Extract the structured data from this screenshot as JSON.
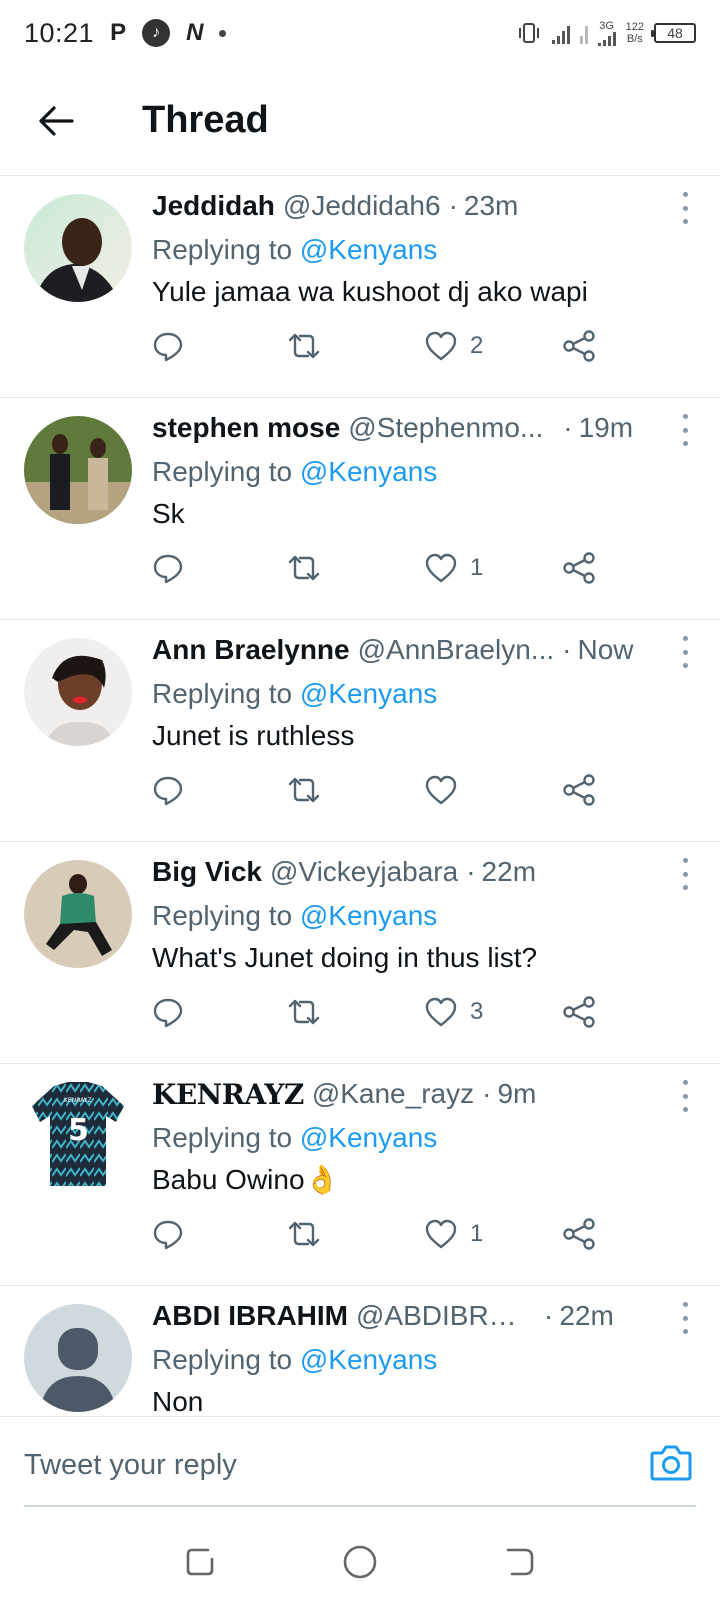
{
  "status_bar": {
    "time": "10:21",
    "left_icons": [
      "p-icon",
      "tiktok-icon",
      "n-icon",
      "dot"
    ],
    "p_glyph": "P",
    "n_glyph": "N",
    "network": "3G",
    "speed_value": "122",
    "speed_unit": "B/s",
    "battery": "48"
  },
  "header": {
    "title": "Thread",
    "back_icon": "arrow-left-icon"
  },
  "tweets": [
    {
      "name": "Jeddidah",
      "handle": "@Jeddidah6",
      "sep": "·",
      "time": "23m",
      "replying_prefix": "Replying to ",
      "replying_to": "@Kenyans",
      "text": "Yule jamaa wa kushoot dj ako wapi",
      "likes": "2"
    },
    {
      "name": "stephen mose",
      "handle": "@Stephenmo...",
      "sep": "·",
      "time": "19m",
      "replying_prefix": "Replying to ",
      "replying_to": "@Kenyans",
      "text": "Sk",
      "likes": "1"
    },
    {
      "name": "Ann Braelynne",
      "handle": "@AnnBraelyn...",
      "sep": "·",
      "time": "Now",
      "replying_prefix": "Replying to ",
      "replying_to": "@Kenyans",
      "text": "Junet is ruthless",
      "likes": ""
    },
    {
      "name": "Big Vick",
      "handle": "@Vickeyjabara",
      "sep": "·",
      "time": "22m",
      "replying_prefix": "Replying to ",
      "replying_to": "@Kenyans",
      "text": "What's Junet doing in thus list?",
      "likes": "3"
    },
    {
      "name": "KENRAYZ",
      "handle": "@Kane_rayz",
      "sep": "·",
      "time": "9m",
      "replying_prefix": "Replying to ",
      "replying_to": "@Kenyans",
      "text": "Babu Owino👌",
      "likes": "1",
      "jersey_number": "5",
      "jersey_name": "KENRAYZ"
    },
    {
      "name": "ABDI IBRAHIM",
      "handle": "@ABDIBRAH...",
      "sep": "·",
      "time": "22m",
      "replying_prefix": "Replying to ",
      "replying_to": "@Kenyans",
      "text": "Non",
      "likes": ""
    }
  ],
  "reply_bar": {
    "placeholder": "Tweet your reply",
    "camera_icon": "camera-icon"
  },
  "nav_bar": {
    "icons": [
      "recents-icon",
      "home-icon",
      "back-icon"
    ]
  },
  "colors": {
    "accent": "#1d9bf0",
    "secondary_text": "#536471",
    "primary_text": "#0f1419",
    "divider": "#e6e9ec"
  }
}
